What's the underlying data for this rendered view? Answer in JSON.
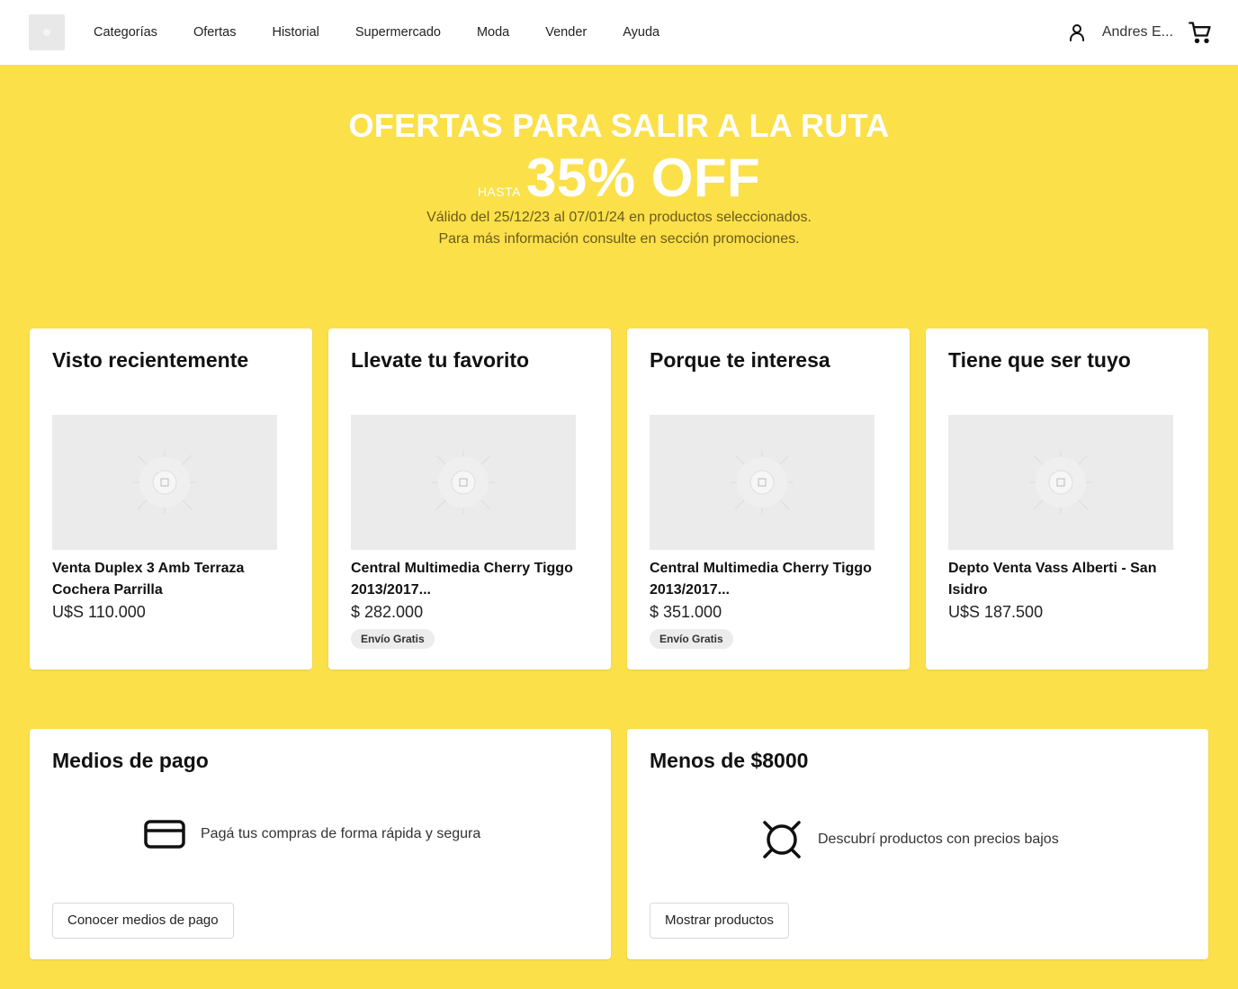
{
  "header": {
    "nav": [
      "Categorías",
      "Ofertas",
      "Historial",
      "Supermercado",
      "Moda",
      "Vender",
      "Ayuda"
    ],
    "user_name": "Andres E...",
    "icons": {
      "user": "user-icon",
      "cart": "cart-icon",
      "logo": "logo-placeholder"
    }
  },
  "hero": {
    "title": "OFERTAS PARA SALIR A LA RUTA",
    "until": "HASTA",
    "discount": "35% OFF",
    "line1": "Válido del 25/12/23 al 07/01/24 en productos seleccionados.",
    "line2": "Para más información consulte en sección promociones.",
    "background_color": "#fbe04a"
  },
  "cards": [
    {
      "title": "Visto recientemente",
      "product": "Venta Duplex 3 Amb Terraza Cochera Parrilla",
      "price": "U$S 110.000",
      "badge": ""
    },
    {
      "title": "Llevate tu favorito",
      "product": "Central Multimedia Cherry Tiggo 2013/2017...",
      "price": "$ 282.000",
      "badge": "Envío Gratis"
    },
    {
      "title": "Porque te interesa",
      "product": "Central Multimedia Cherry Tiggo 2013/2017...",
      "price": "$ 351.000",
      "badge": "Envío Gratis"
    },
    {
      "title": "Tiene que ser tuyo",
      "product": "Depto Venta Vass Alberti - San Isidro",
      "price": "U$S 187.500",
      "badge": ""
    }
  ],
  "payment": {
    "title": "Medios de pago",
    "text": "Pagá tus compras de forma rápida y segura",
    "button": "Conocer medios de pago",
    "icon": "credit-card-icon"
  },
  "cheap": {
    "title": "Menos de $8000",
    "text": "Descubrí productos con precios bajos",
    "button": "Mostrar productos",
    "icon": "currency-icon"
  }
}
